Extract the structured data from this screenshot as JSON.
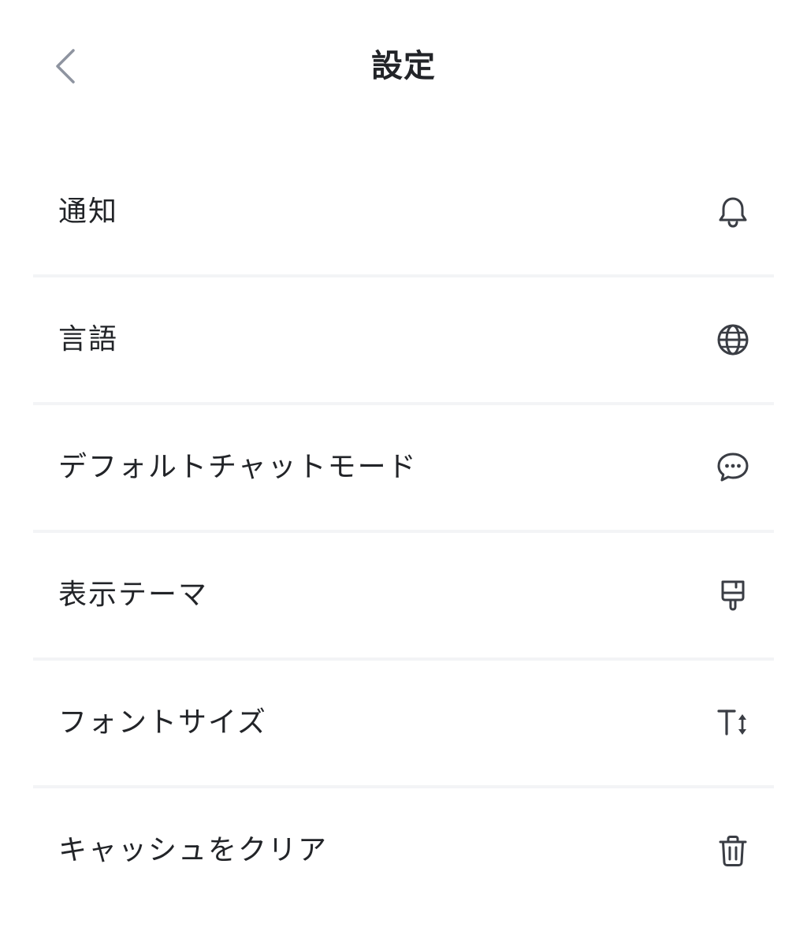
{
  "header": {
    "title": "設定",
    "back_icon": "chevron-left-icon"
  },
  "settings": {
    "items": [
      {
        "label": "通知",
        "icon": "bell-icon"
      },
      {
        "label": "言語",
        "icon": "globe-icon"
      },
      {
        "label": "デフォルトチャットモード",
        "icon": "chat-bubble-icon"
      },
      {
        "label": "表示テーマ",
        "icon": "paint-brush-icon"
      },
      {
        "label": "フォントサイズ",
        "icon": "text-size-icon"
      },
      {
        "label": "キャッシュをクリア",
        "icon": "trash-icon"
      }
    ]
  },
  "colors": {
    "text": "#222428",
    "icon": "#3a3d44",
    "back_icon": "#8e94a0",
    "divider": "#f3f4f6",
    "background": "#ffffff"
  }
}
